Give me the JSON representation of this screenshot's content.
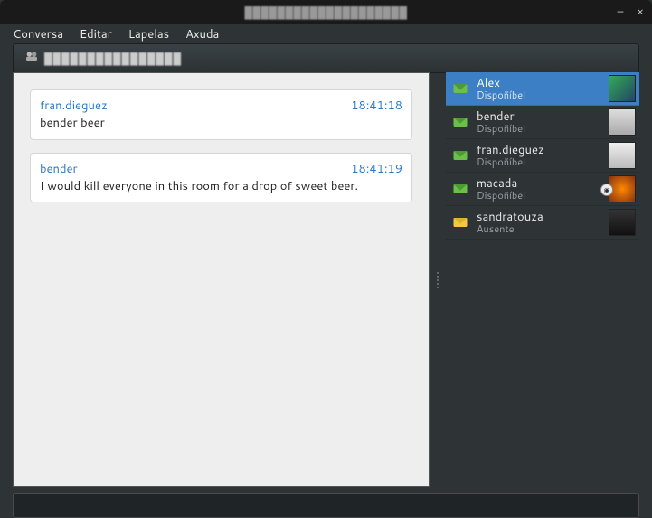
{
  "window": {
    "title": "████████████████████"
  },
  "menu": {
    "conversa": "Conversa",
    "editar": "Editar",
    "lapelas": "Lapelas",
    "axuda": "Axuda"
  },
  "tab": {
    "label": "████████████████"
  },
  "messages": [
    {
      "sender": "fran.dieguez",
      "time": "18:41:18",
      "body": "bender beer"
    },
    {
      "sender": "bender",
      "time": "18:41:19",
      "body": "I would kill everyone in this room for a drop of sweet beer."
    }
  ],
  "roster": [
    {
      "name": "Alex",
      "status": "Dispoñíbel",
      "presence": "available",
      "selected": true,
      "camera": false
    },
    {
      "name": "bender",
      "status": "Dispoñíbel",
      "presence": "available",
      "selected": false,
      "camera": false
    },
    {
      "name": "fran.dieguez",
      "status": "Dispoñíbel",
      "presence": "available",
      "selected": false,
      "camera": false
    },
    {
      "name": "macada",
      "status": "Dispoñíbel",
      "presence": "available",
      "selected": false,
      "camera": true
    },
    {
      "name": "sandratouza",
      "status": "Ausente",
      "presence": "away",
      "selected": false,
      "camera": false
    }
  ]
}
